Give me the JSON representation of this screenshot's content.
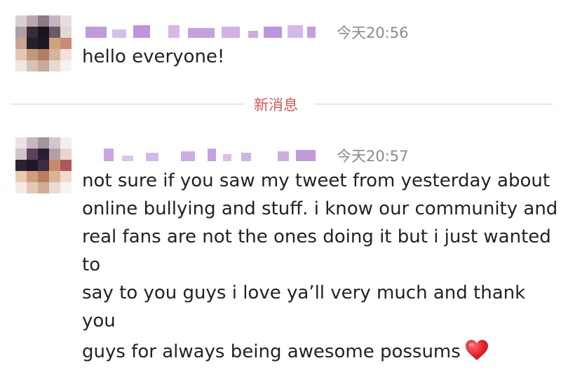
{
  "messages": [
    {
      "timestamp": "今天20:56",
      "text": "hello everyone!"
    },
    {
      "timestamp": "今天20:57",
      "lines": [
        "not sure if you saw my tweet from yesterday about",
        "online bullying and stuff. i know our community and",
        "real fans are not the ones doing it but i just wanted to",
        "say to you guys i love ya’ll very much and thank you",
        "guys for always being awesome possums"
      ],
      "emoji": "heart-emoji"
    }
  ],
  "divider": {
    "label": "新消息"
  },
  "colors": {
    "divider_text": "#d55a55",
    "divider_line": "#ecc6c3",
    "timestamp": "#8a8a8a",
    "name_blur": "#b58ad6",
    "heart": "#e0202b"
  }
}
